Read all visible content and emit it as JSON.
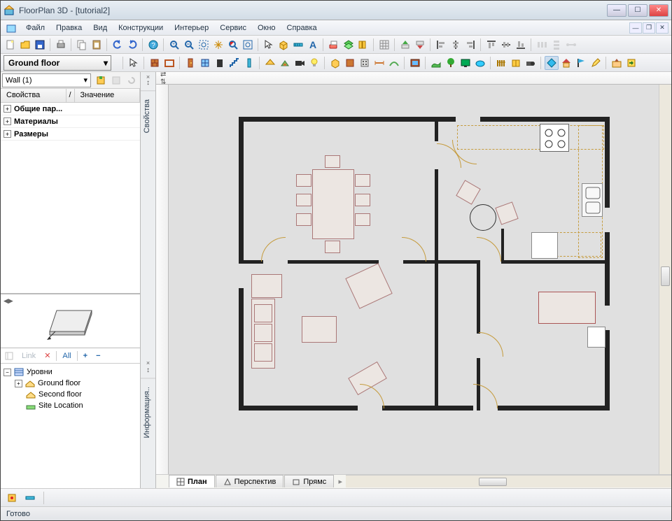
{
  "title": "FloorPlan 3D - [tutorial2]",
  "menu": [
    "Файл",
    "Правка",
    "Вид",
    "Конструкции",
    "Интерьер",
    "Сервис",
    "Окно",
    "Справка"
  ],
  "floor_selector": "Ground floor",
  "wall_selector": "Wall (1)",
  "props": {
    "head_prop": "Свойства",
    "head_sep": "/",
    "head_val": "Значение",
    "rows": [
      "Общие пар...",
      "Материалы",
      "Размеры"
    ]
  },
  "levels": {
    "toolbar": {
      "link": "Link",
      "all": "All",
      "plus": "+",
      "minus": "−"
    },
    "root": "Уровни",
    "items": [
      "Ground floor",
      "Second floor",
      "Site Location"
    ]
  },
  "vtabs": {
    "props": "Свойства",
    "info": "Информация.."
  },
  "view_tabs": {
    "plan": "План",
    "persp": "Перспектив",
    "direct": "Прямс"
  },
  "status": "Готово",
  "winbtns": {
    "min": "—",
    "max": "☐",
    "close": "✕"
  }
}
